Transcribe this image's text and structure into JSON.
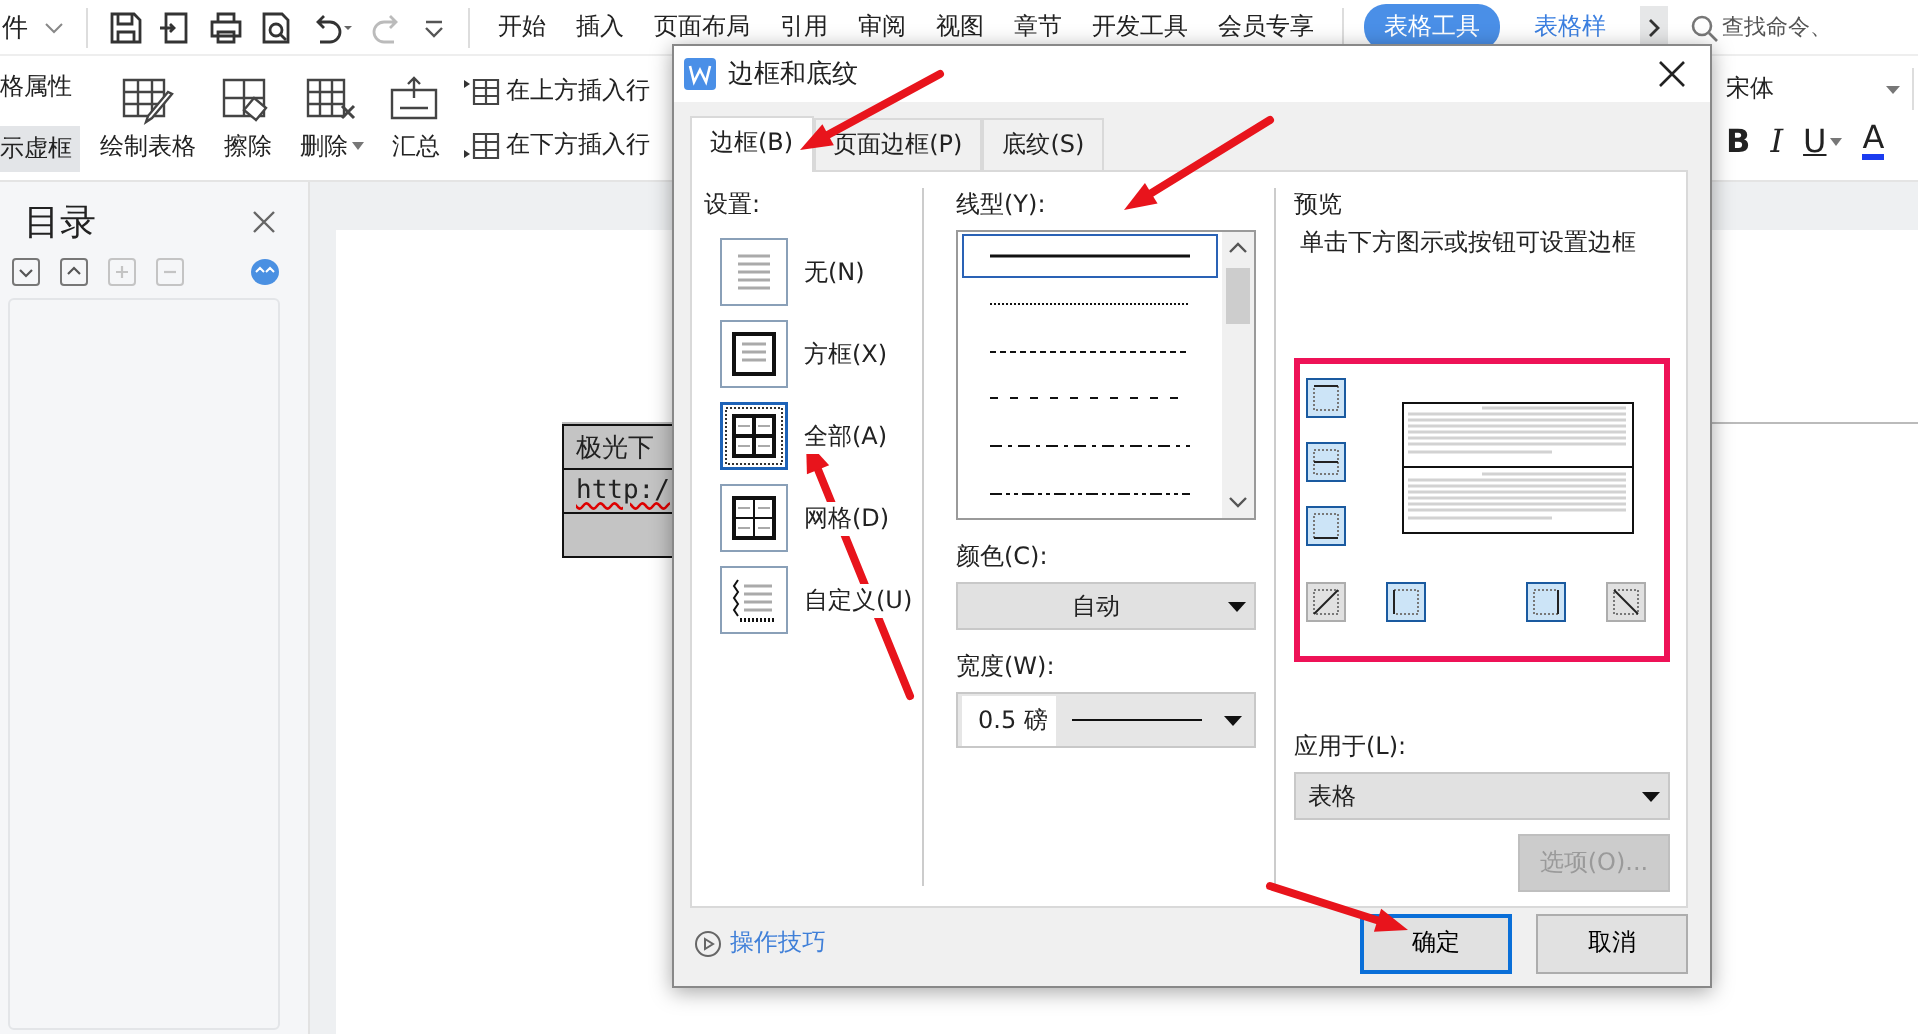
{
  "menu_bar": {
    "file_menu": "件",
    "tabs": [
      {
        "label": "开始",
        "selected": false
      },
      {
        "label": "插入",
        "selected": false
      },
      {
        "label": "页面布局",
        "selected": false
      },
      {
        "label": "引用",
        "selected": false
      },
      {
        "label": "审阅",
        "selected": false
      },
      {
        "label": "视图",
        "selected": false
      },
      {
        "label": "章节",
        "selected": false
      },
      {
        "label": "开发工具",
        "selected": false
      },
      {
        "label": "会员专享",
        "selected": false
      }
    ],
    "context_tabs": [
      {
        "label": "表格工具",
        "selected": true
      },
      {
        "label": "表格样",
        "selected": false
      }
    ],
    "search": {
      "placeholder": "查找命令、"
    }
  },
  "ribbon": {
    "toggles": [
      {
        "label": "格属性",
        "on": false
      },
      {
        "label": "示虚框",
        "on": true
      }
    ],
    "tools": [
      {
        "kind": "draw",
        "label": "绘制表格",
        "dropdown": false
      },
      {
        "kind": "erase",
        "label": "擦除",
        "dropdown": false
      },
      {
        "kind": "delete",
        "label": "删除",
        "dropdown": true
      },
      {
        "kind": "summary",
        "label": "汇总",
        "dropdown": false
      }
    ],
    "insert_rows": [
      {
        "kind": "above",
        "label": "在上方插入行"
      },
      {
        "kind": "below",
        "label": "在下方插入行"
      }
    ],
    "font": "宋体",
    "format_buttons": [
      {
        "kind": "bold",
        "label": "B"
      },
      {
        "kind": "italic",
        "label": "I"
      },
      {
        "kind": "underline",
        "label": "U"
      },
      {
        "kind": "color",
        "label": "A"
      }
    ]
  },
  "toc_panel": {
    "title": "目录",
    "tools": [
      {
        "kind": "expand",
        "disabled": false
      },
      {
        "kind": "collapse",
        "disabled": false
      },
      {
        "kind": "add",
        "disabled": true
      },
      {
        "kind": "remove",
        "disabled": true
      }
    ]
  },
  "document": {
    "table_rows": [
      {
        "text": "极光下",
        "spell_error": false
      },
      {
        "text": "http:/",
        "spell_error": true
      }
    ]
  },
  "dialog": {
    "title": "边框和底纹",
    "tabs": [
      {
        "label": "边框(B)",
        "selected": true
      },
      {
        "label": "页面边框(P)",
        "selected": false
      },
      {
        "label": "底纹(S)",
        "selected": false
      }
    ],
    "settings": {
      "label": "设置:",
      "options": [
        {
          "kind": "none",
          "label": "无(N)",
          "selected": false
        },
        {
          "kind": "box",
          "label": "方框(X)",
          "selected": false
        },
        {
          "kind": "all",
          "label": "全部(A)",
          "selected": true
        },
        {
          "kind": "grid",
          "label": "网格(D)",
          "selected": false
        },
        {
          "kind": "custom",
          "label": "自定义(U)",
          "selected": false
        }
      ]
    },
    "line_style": {
      "label": "线型(Y):",
      "styles": [
        {
          "kind": "solid",
          "selected": true
        },
        {
          "kind": "dotted",
          "selected": false
        },
        {
          "kind": "dashed",
          "selected": false
        },
        {
          "kind": "sparse-dashed",
          "selected": false
        },
        {
          "kind": "dash-dot",
          "selected": false
        },
        {
          "kind": "dash-dot-dot",
          "selected": false
        }
      ]
    },
    "color": {
      "label": "颜色(C):",
      "value": "自动"
    },
    "width": {
      "label": "宽度(W):",
      "value": "0.5 磅"
    },
    "preview": {
      "title": "预览",
      "hint": "单击下方图示或按钮可设置边框",
      "side_buttons": [
        {
          "kind": "top",
          "on": true
        },
        {
          "kind": "inner-horizontal",
          "on": true
        },
        {
          "kind": "bottom",
          "on": true
        }
      ],
      "bottom_buttons": [
        {
          "kind": "diagonal-up",
          "on": false
        },
        {
          "kind": "left",
          "on": true
        },
        {
          "kind": "right",
          "on": true
        },
        {
          "kind": "diagonal-down",
          "on": false
        }
      ]
    },
    "apply_to": {
      "label": "应用于(L):",
      "value": "表格"
    },
    "options_button": {
      "label": "选项(O)...",
      "disabled": true
    },
    "tips_link": "操作技巧",
    "ok_button": "确定",
    "cancel_button": "取消"
  }
}
